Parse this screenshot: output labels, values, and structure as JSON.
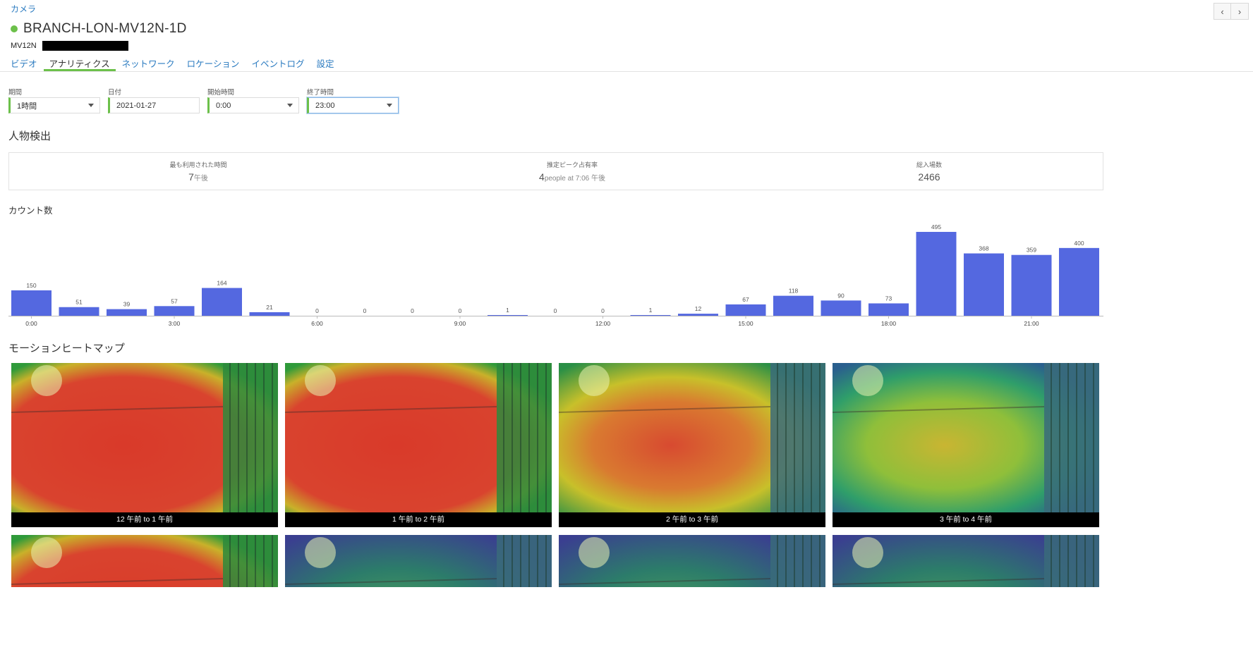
{
  "breadcrumb": "カメラ",
  "device": {
    "name": "BRANCH-LON-MV12N-1D",
    "model": "MV12N",
    "status_color": "#6cc04a"
  },
  "tabs": [
    {
      "label": "ビデオ",
      "active": false
    },
    {
      "label": "アナリティクス",
      "active": true
    },
    {
      "label": "ネットワーク",
      "active": false
    },
    {
      "label": "ロケーション",
      "active": false
    },
    {
      "label": "イベントログ",
      "active": false
    },
    {
      "label": "設定",
      "active": false
    }
  ],
  "filters": {
    "period": {
      "label": "期間",
      "value": "1時間"
    },
    "date": {
      "label": "日付",
      "value": "2021-01-27"
    },
    "start": {
      "label": "開始時間",
      "value": "0:00"
    },
    "end": {
      "label": "終了時間",
      "value": "23:00"
    }
  },
  "people_detection": {
    "title": "人物検出",
    "most_used": {
      "label": "最も利用された時間",
      "value": "7",
      "unit": "午後"
    },
    "peak": {
      "label": "推定ピーク占有率",
      "value": "4",
      "unit": "people at 7:06 午後"
    },
    "total": {
      "label": "総入場数",
      "value": "2466"
    }
  },
  "chart_title": "カウント数",
  "chart_data": {
    "type": "bar",
    "categories": [
      "0:00",
      "1:00",
      "2:00",
      "3:00",
      "4:00",
      "5:00",
      "6:00",
      "7:00",
      "8:00",
      "9:00",
      "10:00",
      "11:00",
      "12:00",
      "13:00",
      "14:00",
      "15:00",
      "16:00",
      "17:00",
      "18:00",
      "19:00",
      "20:00",
      "21:00",
      "22:00"
    ],
    "values": [
      150,
      51,
      39,
      57,
      164,
      21,
      0,
      0,
      0,
      0,
      1,
      0,
      0,
      1,
      12,
      67,
      118,
      90,
      73,
      495,
      368,
      359,
      400
    ],
    "tick_labels": [
      "0:00",
      "3:00",
      "6:00",
      "9:00",
      "12:00",
      "15:00",
      "18:00",
      "21:00"
    ],
    "ylim": [
      0,
      520
    ],
    "bar_color": "#5468e0",
    "grid": false,
    "data_labels": true
  },
  "heatmap_title": "モーションヒートマップ",
  "heatmaps": [
    {
      "caption": "12 午前 to 1 午前",
      "intensity": 1.0
    },
    {
      "caption": "1 午前 to 2 午前",
      "intensity": 0.8
    },
    {
      "caption": "2 午前 to 3 午前",
      "intensity": 0.6
    },
    {
      "caption": "3 午前 to 4 午前",
      "intensity": 0.35
    },
    {
      "caption": "",
      "intensity": 0.9
    },
    {
      "caption": "",
      "intensity": 0.2
    },
    {
      "caption": "",
      "intensity": 0.1
    },
    {
      "caption": "",
      "intensity": 0.1
    }
  ]
}
